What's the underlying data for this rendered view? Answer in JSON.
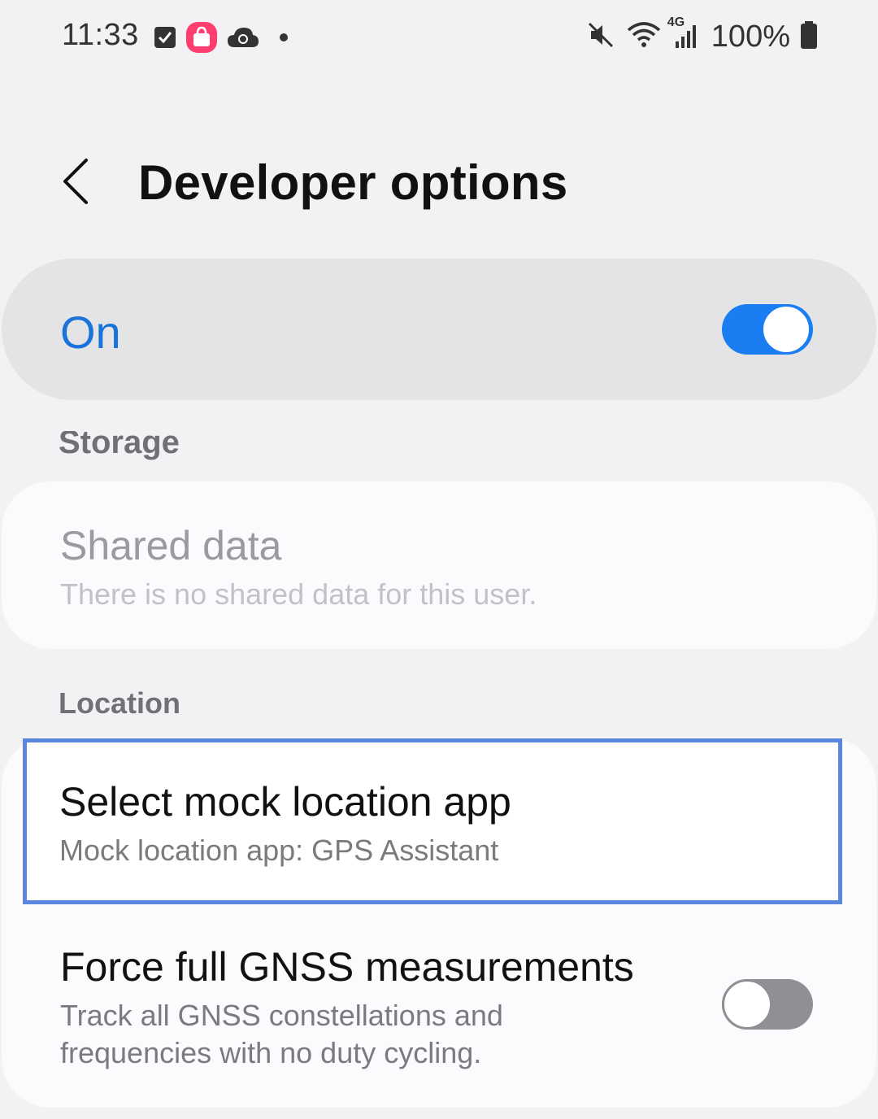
{
  "status_bar": {
    "time": "11:33",
    "left_icons": [
      "checkbox-notification-icon",
      "shopping-app-icon",
      "cloud-sync-icon",
      "more-notifications-dot-icon"
    ],
    "right_icons": [
      "mute-icon",
      "wifi-icon",
      "network-4g-icon",
      "signal-icon"
    ],
    "network_label": "4G",
    "battery_text": "100%"
  },
  "header": {
    "title": "Developer options",
    "back_icon": "chevron-left-icon"
  },
  "master_switch": {
    "label": "On",
    "state": "on",
    "accent_color": "#1a7ef2"
  },
  "sections": {
    "storage": {
      "header": "Storage",
      "items": [
        {
          "title": "Shared data",
          "subtitle": "There is no shared data for this user.",
          "enabled": false
        }
      ]
    },
    "location": {
      "header": "Location",
      "items": [
        {
          "title": "Select mock location app",
          "subtitle": "Mock location app: GPS Assistant",
          "highlighted": true
        },
        {
          "title": "Force full GNSS measurements",
          "subtitle_line1": "Track all GNSS constellations and",
          "subtitle_line2": "frequencies with no duty cycling.",
          "toggle_state": "off"
        }
      ]
    }
  }
}
